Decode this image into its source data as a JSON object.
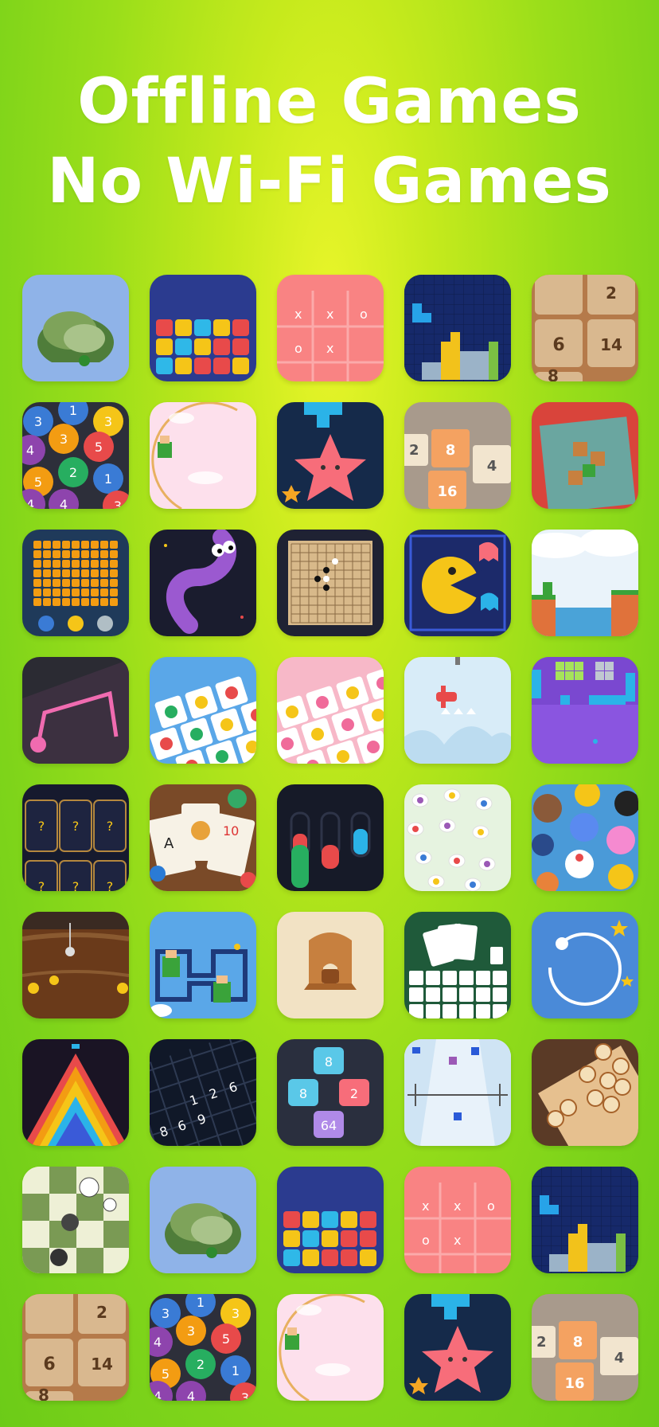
{
  "headline": {
    "line1": "Offline Games",
    "line2": "No Wi-Fi Games"
  },
  "colors": {
    "background_center": "#e9f52a",
    "background_edge": "#6ccb18",
    "headline_text": "#ffffff"
  },
  "tiles": [
    [
      "tree-runner",
      "star-blocks",
      "tic-tac-toe",
      "block-puzzle",
      "number-merge-2048"
    ],
    [
      "number-balls",
      "jump-circle",
      "star-tetris",
      "merge-tiles",
      "box-pusher"
    ],
    [
      "block-grid",
      "worm",
      "gomoku",
      "maze-chomper",
      "flappy-jumper"
    ],
    [
      "one-line-path",
      "fruit-tiles",
      "flower-tiles",
      "plane-flight",
      "brick-breaker"
    ],
    [
      "memory-cards",
      "joker-cards",
      "water-sort",
      "bug-match",
      "animal-match"
    ],
    [
      "gold-miner",
      "hero-maze",
      "wood-block",
      "solitaire",
      "orbit-ball"
    ],
    [
      "stack-pyramid",
      "sudoku",
      "number-hex",
      "ski-race",
      "chinese-chess"
    ],
    [
      "chess",
      "tree-runner",
      "star-blocks",
      "tic-tac-toe",
      "block-puzzle"
    ],
    [
      "number-merge-2048",
      "number-balls",
      "jump-circle",
      "star-tetris",
      "merge-tiles"
    ]
  ]
}
